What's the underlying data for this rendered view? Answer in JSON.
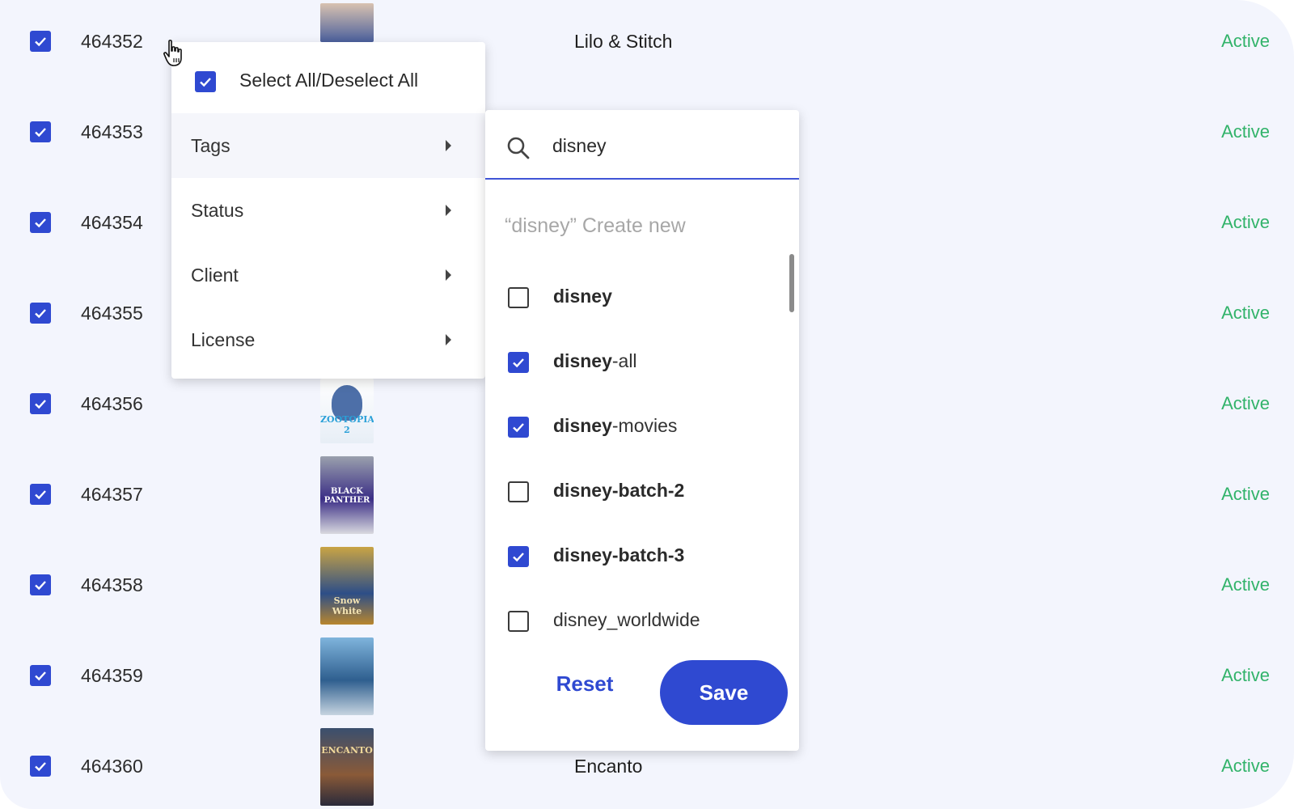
{
  "rows": [
    {
      "id": "464352",
      "title": "Lilo & Stitch",
      "status": "Active"
    },
    {
      "id": "464353",
      "title": "",
      "status": "Active"
    },
    {
      "id": "464354",
      "title": "",
      "status": "Active"
    },
    {
      "id": "464355",
      "title": "",
      "status": "Active"
    },
    {
      "id": "464356",
      "title": "",
      "status": "Active"
    },
    {
      "id": "464357",
      "title": "",
      "status": "Active"
    },
    {
      "id": "464358",
      "title": "",
      "status": "Active"
    },
    {
      "id": "464359",
      "title": "",
      "status": "Active"
    },
    {
      "id": "464360",
      "title": "Encanto",
      "status": "Active"
    }
  ],
  "thumbs": {
    "zootopia": "ZOOTOPIA 2",
    "panther": "BLACK PANTHER",
    "snowwhite": "Snow White",
    "encanto": "ENCANTO"
  },
  "menu": {
    "select_all": "Select All/Deselect All",
    "items": [
      {
        "label": "Tags",
        "active": true
      },
      {
        "label": "Status"
      },
      {
        "label": "Client"
      },
      {
        "label": "License"
      }
    ]
  },
  "tags": {
    "search_value": "disney",
    "create_quote": "“disney”",
    "create_label": "Create new",
    "options": [
      {
        "match": "disney",
        "rest": "",
        "checked": false
      },
      {
        "match": "disney",
        "rest": "-all",
        "checked": true
      },
      {
        "match": "disney",
        "rest": "-movies",
        "checked": true
      },
      {
        "match": "disney-batch-2",
        "rest": "",
        "checked": false
      },
      {
        "match": "disney-batch-3",
        "rest": "",
        "checked": true
      },
      {
        "match": "",
        "rest": "disney_worldwide",
        "checked": false
      }
    ],
    "reset_label": "Reset",
    "save_label": "Save"
  },
  "colors": {
    "accent": "#2f49d1",
    "status_active": "#32b36a",
    "background": "#f3f5fd"
  }
}
